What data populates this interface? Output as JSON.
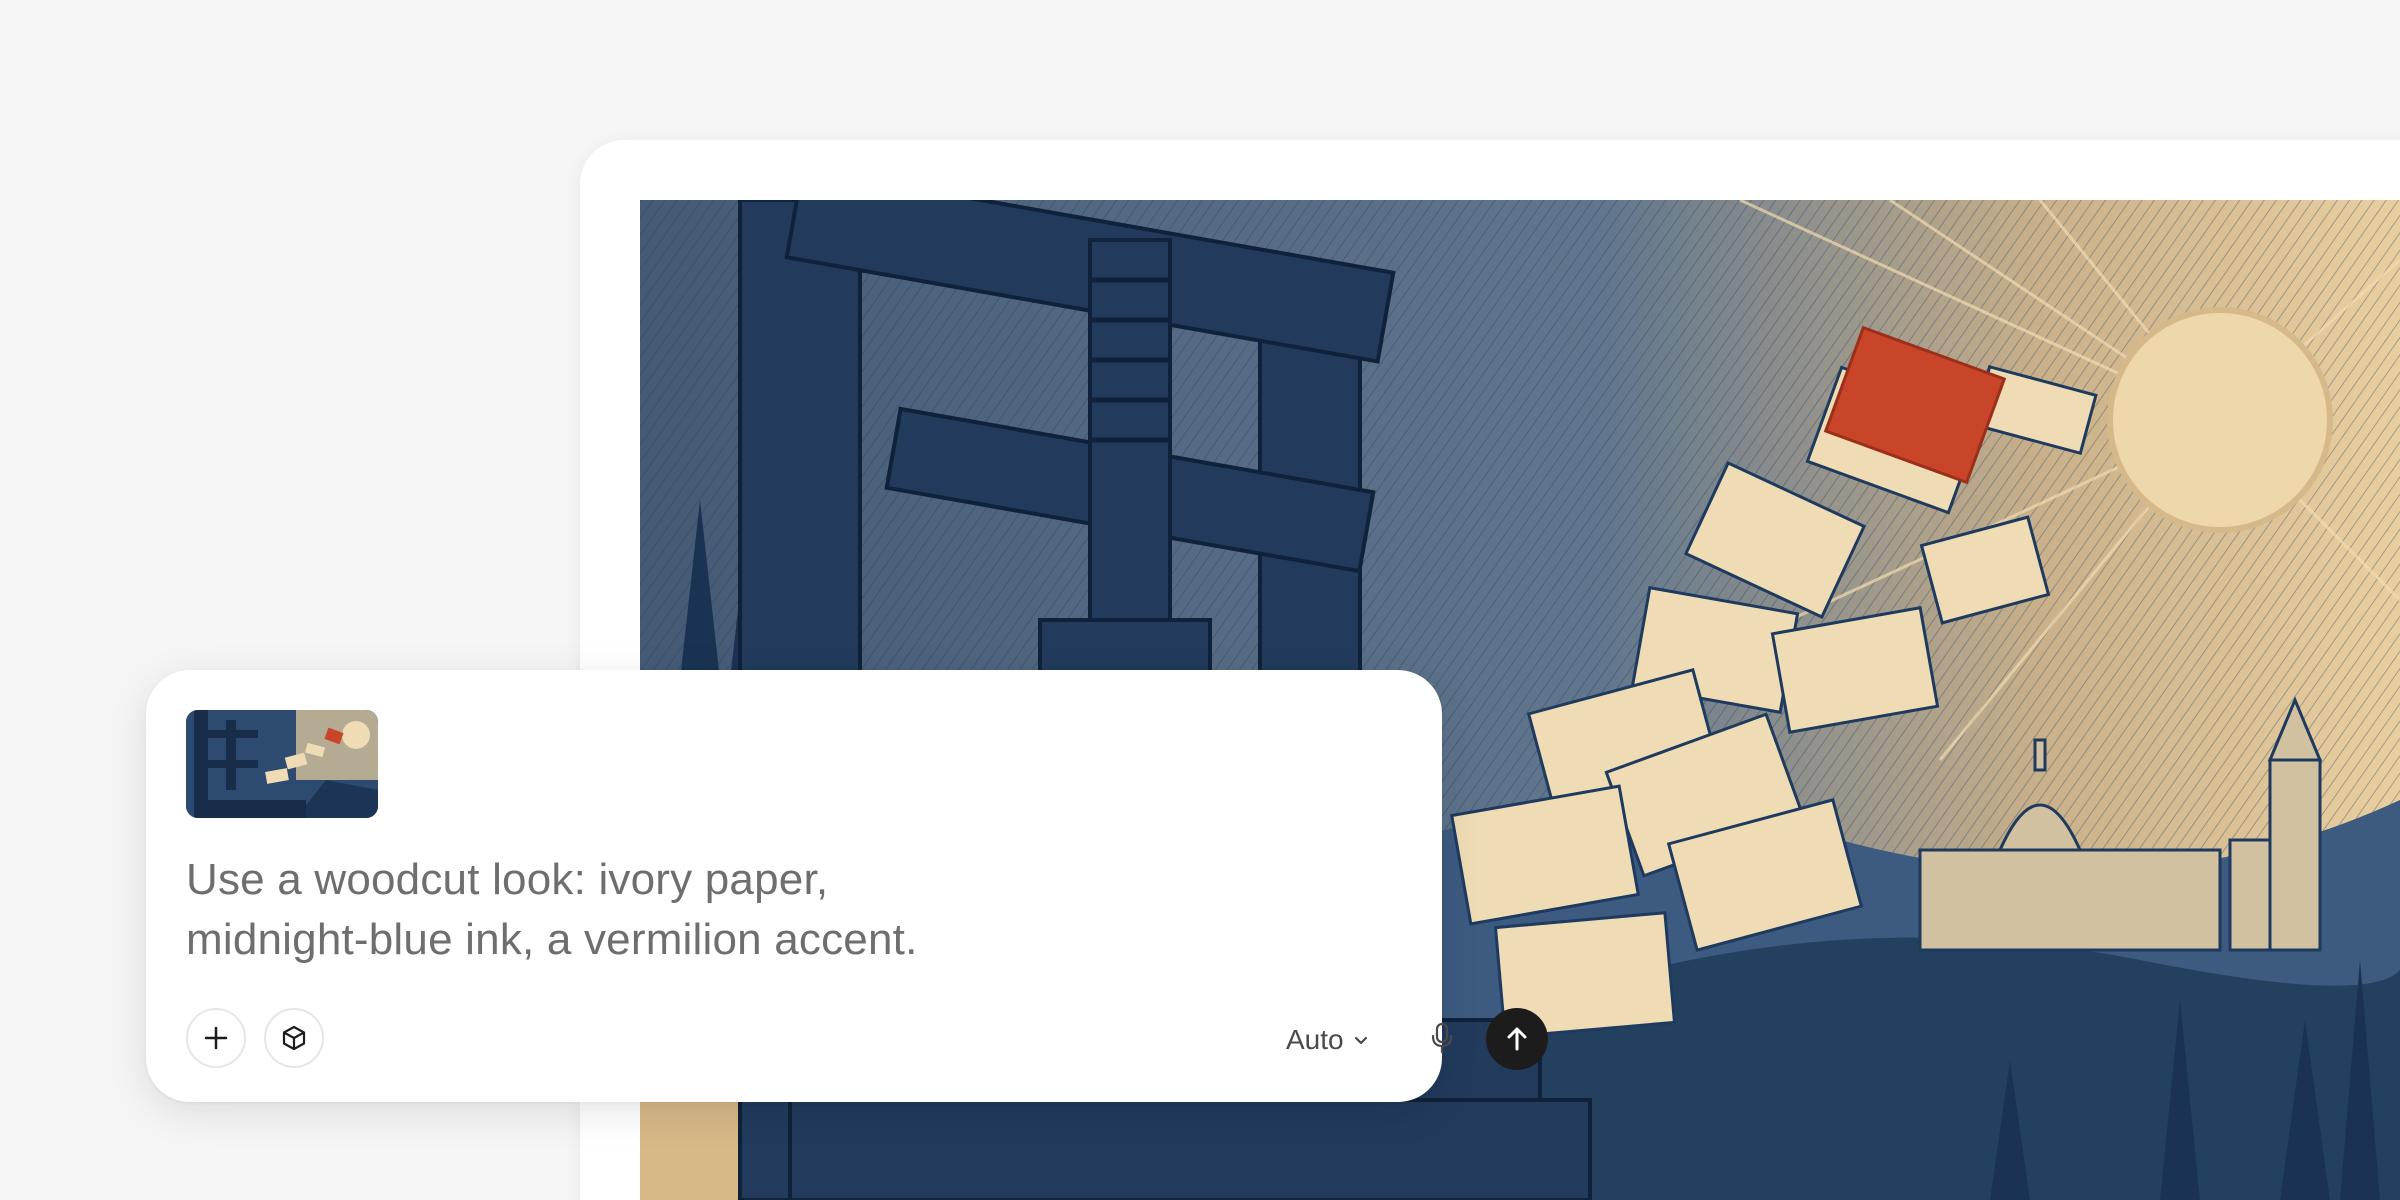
{
  "artwork": {
    "icon": "woodcut-printing-press-image",
    "palette": {
      "paper": "#e8cfa0",
      "ink": "#1e3a5f",
      "accent": "#c8452a"
    }
  },
  "composer": {
    "attachment_icon": "image-thumbnail",
    "prompt_text": "Use a woodcut look: ivory paper,\nmidnight-blue ink, a vermilion accent.",
    "buttons": {
      "add_icon": "plus-icon",
      "tools_icon": "cube-icon",
      "mic_icon": "microphone-icon",
      "send_icon": "arrow-up-icon"
    },
    "model_select": {
      "label": "Auto",
      "icon": "chevron-down-icon"
    }
  }
}
